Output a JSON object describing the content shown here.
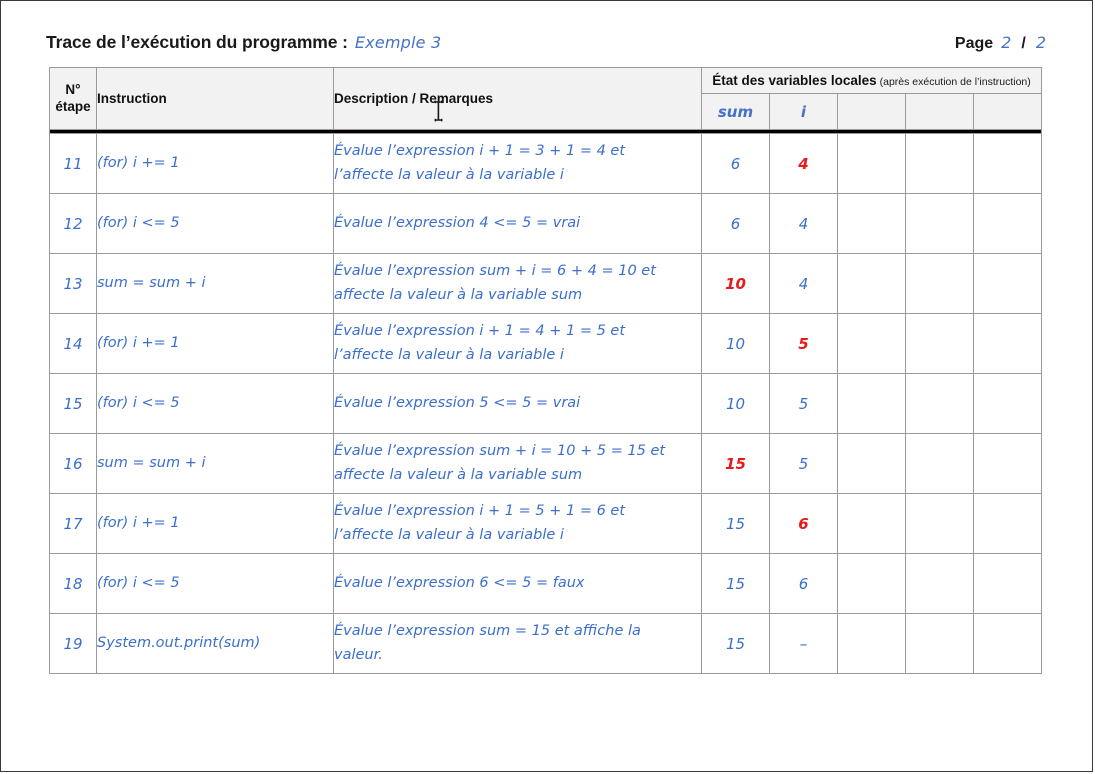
{
  "header": {
    "title": "Trace de l’exécution du programme :",
    "example_label": "Exemple 3",
    "page_word": "Page",
    "page_current": "2",
    "page_separator": "/",
    "page_total": "2"
  },
  "table": {
    "columns": {
      "step_line1": "N°",
      "step_line2": "étape",
      "instruction": "Instruction",
      "description": "Description / Remarques",
      "variables_group_title": "État des variables locales",
      "variables_group_note": "(après exécution de l’instruction)",
      "var1": "sum",
      "var2": "i",
      "var3": "",
      "var4": "",
      "var5": ""
    },
    "rows": [
      {
        "step": "11",
        "instruction": "(for) i += 1",
        "description_line1": "Évalue l’expression i + 1 = 3 + 1 = 4 et",
        "description_line2": "l’affecte la valeur à la variable i",
        "sum": "6",
        "sum_changed": false,
        "i": "4",
        "i_changed": true,
        "v3": "",
        "v4": "",
        "v5": ""
      },
      {
        "step": "12",
        "instruction": "(for) i <= 5",
        "description_line1": "Évalue l’expression 4 <= 5 = vrai",
        "description_line2": "",
        "sum": "6",
        "sum_changed": false,
        "i": "4",
        "i_changed": false,
        "v3": "",
        "v4": "",
        "v5": ""
      },
      {
        "step": "13",
        "instruction": "sum = sum + i",
        "description_line1": "Évalue l’expression sum + i = 6 + 4 = 10 et",
        "description_line2": "affecte la valeur à la variable sum",
        "sum": "10",
        "sum_changed": true,
        "i": "4",
        "i_changed": false,
        "v3": "",
        "v4": "",
        "v5": ""
      },
      {
        "step": "14",
        "instruction": "(for) i += 1",
        "description_line1": "Évalue l’expression i + 1 = 4 + 1 = 5 et",
        "description_line2": "l’affecte la valeur à la variable i",
        "sum": "10",
        "sum_changed": false,
        "i": "5",
        "i_changed": true,
        "v3": "",
        "v4": "",
        "v5": ""
      },
      {
        "step": "15",
        "instruction": "(for) i <= 5",
        "description_line1": "Évalue l’expression 5 <= 5 = vrai",
        "description_line2": "",
        "sum": "10",
        "sum_changed": false,
        "i": "5",
        "i_changed": false,
        "v3": "",
        "v4": "",
        "v5": ""
      },
      {
        "step": "16",
        "instruction": "sum = sum + i",
        "description_line1": "Évalue l’expression sum + i = 10 + 5 = 15 et",
        "description_line2": "affecte la valeur à la variable sum",
        "sum": "15",
        "sum_changed": true,
        "i": "5",
        "i_changed": false,
        "v3": "",
        "v4": "",
        "v5": ""
      },
      {
        "step": "17",
        "instruction": "(for) i += 1",
        "description_line1": "Évalue l’expression i + 1 = 5 + 1 = 6 et",
        "description_line2": "l’affecte la valeur à la variable i",
        "sum": "15",
        "sum_changed": false,
        "i": "6",
        "i_changed": true,
        "v3": "",
        "v4": "",
        "v5": ""
      },
      {
        "step": "18",
        "instruction": "(for) i <= 5",
        "description_line1": "Évalue l’expression 6 <= 5 = faux",
        "description_line2": "",
        "sum": "15",
        "sum_changed": false,
        "i": "6",
        "i_changed": false,
        "v3": "",
        "v4": "",
        "v5": ""
      },
      {
        "step": "19",
        "instruction": "System.out.print(sum)",
        "description_line1": "Évalue l’expression sum = 15 et affiche la",
        "description_line2": "valeur.",
        "sum": "15",
        "sum_changed": false,
        "i": "–",
        "i_changed": false,
        "v3": "",
        "v4": "",
        "v5": ""
      }
    ]
  },
  "colors": {
    "accent_blue": "#4472c4",
    "body_blue": "#3b6fcc",
    "changed_red": "#e8191b",
    "header_bg": "#f2f2f2",
    "grid_line": "#9a9a9a",
    "page_border": "#3a3a3a"
  },
  "cursor": {
    "type": "ibeam-text-cursor"
  }
}
